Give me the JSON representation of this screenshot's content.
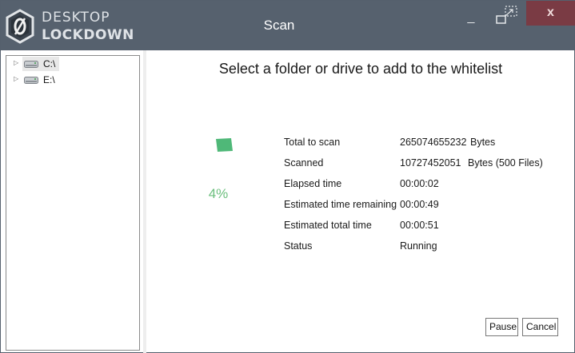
{
  "app": {
    "logo_line1": "DESKTOP",
    "logo_line2": "LOCKDOWN",
    "window_title": "Scan",
    "minimize_label": "_",
    "close_label": "x"
  },
  "tree": {
    "items": [
      {
        "label": "C:\\",
        "icon": "drive-icon",
        "expander": "expand-arrow-icon",
        "selected": true
      },
      {
        "label": "E:\\",
        "icon": "drive-icon",
        "expander": "expand-arrow-icon",
        "selected": false
      }
    ]
  },
  "main": {
    "heading": "Select a folder or drive to add to the whitelist",
    "progress_percent_text": "4%",
    "progress_fraction": 0.04,
    "stats": [
      {
        "label": "Total to scan",
        "value": "265074655232",
        "unit": "Bytes"
      },
      {
        "label": "Scanned",
        "value": "10727452051",
        "unit": "Bytes (500 Files)"
      },
      {
        "label": "Elapsed time",
        "value": "00:00:02",
        "unit": ""
      },
      {
        "label": "Estimated time remaining",
        "value": "00:00:49",
        "unit": ""
      },
      {
        "label": "Estimated total time",
        "value": "00:00:51",
        "unit": ""
      },
      {
        "label": "Status",
        "value": "Running",
        "unit": ""
      }
    ]
  },
  "buttons": {
    "pause": "Pause",
    "cancel": "Cancel"
  },
  "colors": {
    "titlebar": "#56616e",
    "close_button": "#7a3b44",
    "progress_accent": "#4fb878",
    "percent_text": "#6cbf7e"
  }
}
